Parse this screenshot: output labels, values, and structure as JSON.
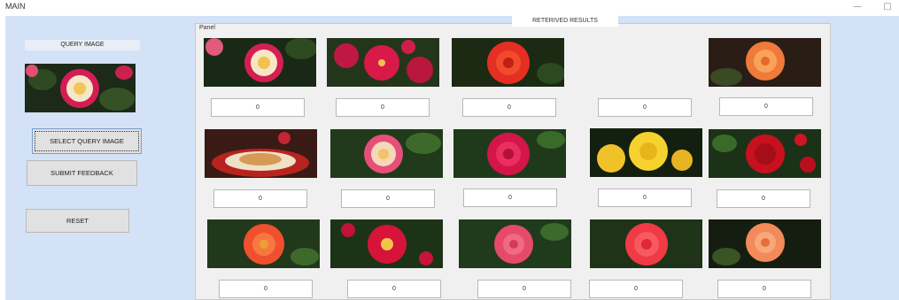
{
  "window": {
    "title": "MAIN",
    "minimize_glyph": "—",
    "maximize_glyph": "□"
  },
  "left": {
    "query_label": "QUERY IMAGE",
    "buttons": {
      "select": "SELECT QUERY IMAGE",
      "submit": "SUBMIT FEEDBACK",
      "reset": "RESET"
    }
  },
  "panel": {
    "title": "Panel",
    "results_tab": "RETERIVED RESULTS"
  },
  "results": [
    {
      "image": "bicolor-rose",
      "score": "0"
    },
    {
      "image": "red-rose-bush",
      "score": "0"
    },
    {
      "image": "red-rose",
      "score": "0"
    },
    {
      "image": "empty",
      "score": "0"
    },
    {
      "image": "orange-rose",
      "score": "0"
    },
    {
      "image": "food-plate",
      "score": "0"
    },
    {
      "image": "pink-bicolor-rose",
      "score": "0"
    },
    {
      "image": "crimson-rose",
      "score": "0"
    },
    {
      "image": "yellow-rose",
      "score": "0"
    },
    {
      "image": "dark-red-rose",
      "score": "0"
    },
    {
      "image": "coral-rose",
      "score": "0"
    },
    {
      "image": "red-yellow-rose",
      "score": "0"
    },
    {
      "image": "pink-rose",
      "score": "0"
    },
    {
      "image": "salmon-rose",
      "score": "0"
    },
    {
      "image": "peach-rose",
      "score": "0"
    }
  ]
}
